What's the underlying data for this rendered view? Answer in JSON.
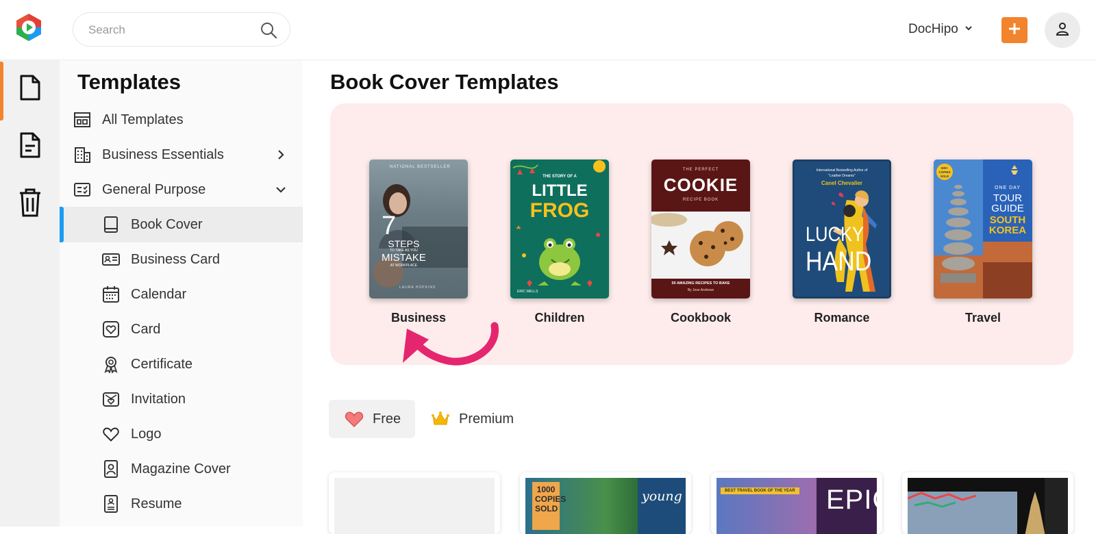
{
  "app": {
    "logo_icon": "dochipo-logo-icon",
    "search_placeholder": "Search",
    "account_name": "DocHipo",
    "add_icon": "plus-icon",
    "avatar_icon": "user-icon",
    "accent_color": "#f2842d",
    "selection_color": "#1b9cf2"
  },
  "rail": {
    "items": [
      {
        "icon": "document-icon",
        "active": true
      },
      {
        "icon": "file-lines-icon",
        "active": false
      },
      {
        "icon": "trash-icon",
        "active": false
      }
    ]
  },
  "sidebar": {
    "title": "Templates",
    "items": [
      {
        "label": "All Templates",
        "icon": "layout-icon"
      },
      {
        "label": "Business Essentials",
        "icon": "building-icon",
        "chevron": "chevron-right-icon"
      },
      {
        "label": "General Purpose",
        "icon": "checklist-icon",
        "chevron": "chevron-down-icon"
      },
      {
        "label": "Book Cover",
        "icon": "book-icon",
        "selected": true
      },
      {
        "label": "Business Card",
        "icon": "id-card-icon"
      },
      {
        "label": "Calendar",
        "icon": "calendar-icon"
      },
      {
        "label": "Card",
        "icon": "heart-card-icon"
      },
      {
        "label": "Certificate",
        "icon": "award-icon"
      },
      {
        "label": "Invitation",
        "icon": "envelope-heart-icon"
      },
      {
        "label": "Logo",
        "icon": "heart-outline-icon"
      },
      {
        "label": "Magazine Cover",
        "icon": "magazine-icon"
      },
      {
        "label": "Resume",
        "icon": "resume-icon"
      }
    ]
  },
  "main": {
    "title": "Book Cover Templates",
    "panel_color": "#fdeceb",
    "categories": [
      {
        "label": "Business",
        "cover": {
          "kicker": "NATIONAL BESTSELLER",
          "big": "7",
          "title_a": "STEPS",
          "small": "TO TAKE AS YOU",
          "title_b": "MISTAKE",
          "sub": "AT WORKPLACE",
          "author": "LAURA HOPKINS"
        }
      },
      {
        "label": "Children",
        "cover": {
          "kicker": "THE STORY OF A",
          "title_a": "LITTLE",
          "title_b": "FROG",
          "author": "ERIC WELLS"
        }
      },
      {
        "label": "Cookbook",
        "cover": {
          "kicker": "THE PERFECT",
          "title_a": "COOKIE",
          "sub": "RECIPE BOOK",
          "footer": "50 AMAZING RECIPES TO BAKE",
          "author": "By Jose Andrews"
        }
      },
      {
        "label": "Romance",
        "cover": {
          "kicker": "International Bestselling Author of",
          "quote": "\"Leather Dreams\"",
          "author": "Canel Chevalier",
          "title_a": "LUCKY",
          "title_b": "HAND"
        }
      },
      {
        "label": "Travel",
        "cover": {
          "badge": "500+ COPIES SOLD",
          "kicker": "ONE DAY",
          "title_a": "TOUR",
          "title_b": "GUIDE",
          "title_c": "SOUTH",
          "title_d": "KOREA"
        }
      }
    ],
    "arrow_color": "#e5266e",
    "filters": [
      {
        "label": "Free",
        "icon": "heart-icon",
        "active": true
      },
      {
        "label": "Premium",
        "icon": "crown-icon",
        "active": false
      }
    ],
    "templates": [
      {
        "thumb": "blank"
      },
      {
        "thumb": "travel-green",
        "badge": "1000 COPIES SOLD",
        "word": "young"
      },
      {
        "thumb": "travel-purple",
        "ribbon": "BEST TRAVEL BOOK OF THE YEAR",
        "word": "EPIC"
      },
      {
        "thumb": "travel-dark"
      }
    ]
  }
}
